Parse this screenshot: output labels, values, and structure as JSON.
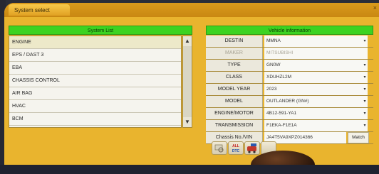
{
  "window": {
    "title": "System select",
    "close_glyph": "×"
  },
  "system_list": {
    "header": "System List",
    "items": [
      "ENGINE",
      "EPS / DAST 3",
      "EBA",
      "CHASSIS CONTROL",
      "AIR BAG",
      "HVAC",
      "BCM"
    ],
    "selected": "ENGINE",
    "scroll_up_glyph": "▲",
    "scroll_down_glyph": "▼"
  },
  "vehicle_info": {
    "header": "Vehicle information",
    "rows": [
      {
        "label": "DESTIN",
        "value": "MMNA"
      },
      {
        "label": "MAKER",
        "value": "MITSUBISHI"
      },
      {
        "label": "TYPE",
        "value": "GN0W"
      },
      {
        "label": "CLASS",
        "value": "XDUHZL2M"
      },
      {
        "label": "MODEL YEAR",
        "value": "2023"
      },
      {
        "label": "MODEL",
        "value": "OUTLANDER (GN#)"
      },
      {
        "label": "ENGINE/MOTOR",
        "value": "4B12-591-YA1"
      },
      {
        "label": "TRANSMISSION",
        "value": "F1EKA-F1E1A"
      }
    ],
    "vin_label": "Chassis No./VIN",
    "vin_value": "JA4T5VA9XPZ014366",
    "match_label": "Match",
    "dropdown_glyph": "▾"
  },
  "toolbar": {
    "dtc_top": "ALL",
    "dtc_bottom": "DTC",
    "icons": [
      "search-icon",
      "all-dtc-icon",
      "vehicle-tool-icon",
      "blank-icon"
    ]
  }
}
